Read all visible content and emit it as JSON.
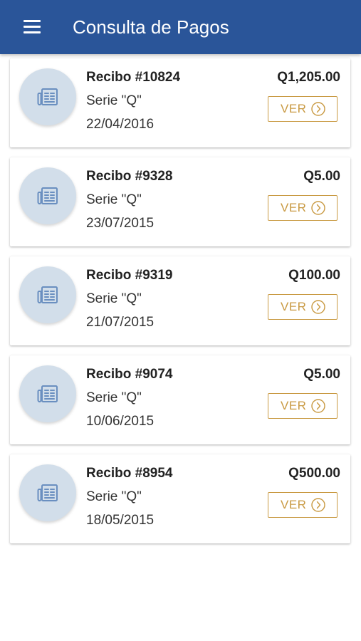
{
  "app_bar": {
    "title": "Consulta de Pagos",
    "background": "#2a5599",
    "menu_icon": "hamburger-menu-icon"
  },
  "colors": {
    "accent": "#c99a43",
    "avatar_bg": "#d2deea",
    "avatar_icon": "#6a8fc0"
  },
  "receipts": [
    {
      "title": "Recibo #10824",
      "serie": "Serie \"Q\"",
      "date": "22/04/2016",
      "amount": "Q1,205.00",
      "button": "VER",
      "icon": "receipt-icon"
    },
    {
      "title": "Recibo #9328",
      "serie": "Serie \"Q\"",
      "date": "23/07/2015",
      "amount": "Q5.00",
      "button": "VER",
      "icon": "receipt-icon"
    },
    {
      "title": "Recibo #9319",
      "serie": "Serie \"Q\"",
      "date": "21/07/2015",
      "amount": "Q100.00",
      "button": "VER",
      "icon": "receipt-icon"
    },
    {
      "title": "Recibo #9074",
      "serie": "Serie \"Q\"",
      "date": "10/06/2015",
      "amount": "Q5.00",
      "button": "VER",
      "icon": "receipt-icon"
    },
    {
      "title": "Recibo #8954",
      "serie": "Serie \"Q\"",
      "date": "18/05/2015",
      "amount": "Q500.00",
      "button": "VER",
      "icon": "receipt-icon"
    }
  ]
}
